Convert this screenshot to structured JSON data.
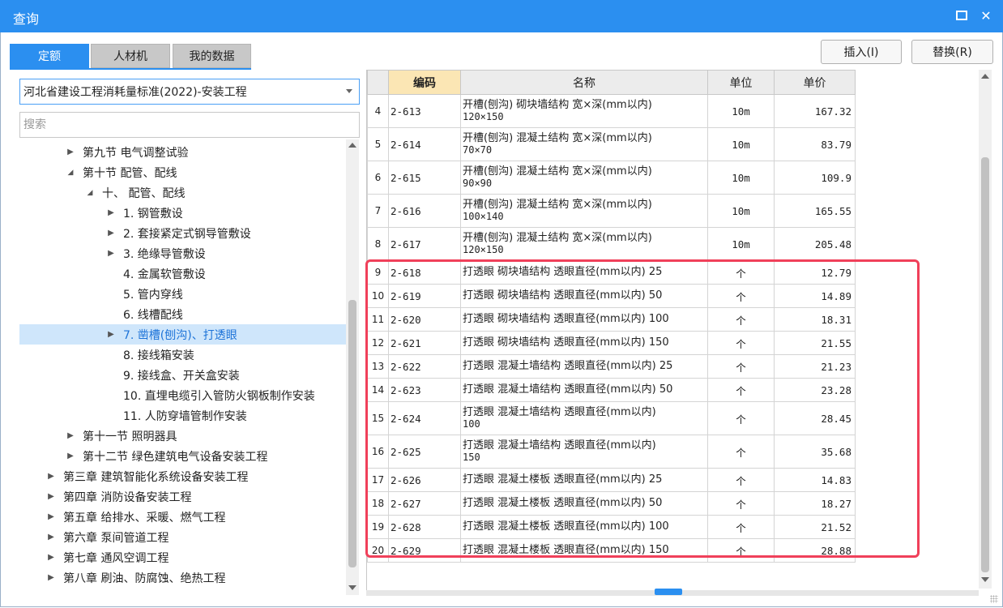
{
  "window": {
    "title": "查询"
  },
  "tabs": [
    {
      "label": "定额",
      "active": true
    },
    {
      "label": "人材机",
      "active": false
    },
    {
      "label": "我的数据",
      "active": false
    }
  ],
  "buttons": {
    "insert": "插入(I)",
    "replace": "替换(R)"
  },
  "library": {
    "selected": "河北省建设工程消耗量标准(2022)-安装工程"
  },
  "search": {
    "placeholder": "搜索",
    "value": ""
  },
  "tree": [
    {
      "label": "第九节 电气调整试验",
      "level": 2,
      "toggle": "collapsed"
    },
    {
      "label": "第十节 配管、配线",
      "level": 2,
      "toggle": "expanded"
    },
    {
      "label": "十、 配管、配线",
      "level": 3,
      "toggle": "expanded"
    },
    {
      "label": "1. 钢管敷设",
      "level": 4,
      "toggle": "collapsed"
    },
    {
      "label": "2. 套接紧定式钢导管敷设",
      "level": 4,
      "toggle": "collapsed"
    },
    {
      "label": "3. 绝缘导管敷设",
      "level": 4,
      "toggle": "collapsed"
    },
    {
      "label": "4. 金属软管敷设",
      "level": 4,
      "toggle": "none"
    },
    {
      "label": "5. 管内穿线",
      "level": 4,
      "toggle": "none"
    },
    {
      "label": "6. 线槽配线",
      "level": 4,
      "toggle": "none"
    },
    {
      "label": "7. 凿槽(刨沟)、打透眼",
      "level": 4,
      "toggle": "collapsed",
      "selected": true
    },
    {
      "label": "8. 接线箱安装",
      "level": 4,
      "toggle": "none"
    },
    {
      "label": "9. 接线盒、开关盒安装",
      "level": 4,
      "toggle": "none"
    },
    {
      "label": "10. 直埋电缆引入管防火钢板制作安装",
      "level": 4,
      "toggle": "none"
    },
    {
      "label": "11. 人防穿墙管制作安装",
      "level": 4,
      "toggle": "none"
    },
    {
      "label": "第十一节 照明器具",
      "level": 2,
      "toggle": "collapsed"
    },
    {
      "label": "第十二节 绿色建筑电气设备安装工程",
      "level": 2,
      "toggle": "collapsed"
    },
    {
      "label": "第三章 建筑智能化系统设备安装工程",
      "level": 1,
      "toggle": "collapsed"
    },
    {
      "label": "第四章 消防设备安装工程",
      "level": 1,
      "toggle": "collapsed"
    },
    {
      "label": "第五章 给排水、采暖、燃气工程",
      "level": 1,
      "toggle": "collapsed"
    },
    {
      "label": "第六章 泵间管道工程",
      "level": 1,
      "toggle": "collapsed"
    },
    {
      "label": "第七章 通风空调工程",
      "level": 1,
      "toggle": "collapsed"
    },
    {
      "label": "第八章 刷油、防腐蚀、绝热工程",
      "level": 1,
      "toggle": "collapsed"
    }
  ],
  "grid": {
    "columns": {
      "code": "编码",
      "name": "名称",
      "unit": "单位",
      "price": "单价"
    },
    "rows": [
      {
        "idx": "4",
        "code": "2-613",
        "name1": "开槽(刨沟) 砌块墙结构 宽×深(mm以内)",
        "name2": "120×150",
        "unit": "10m",
        "price": "167.32"
      },
      {
        "idx": "5",
        "code": "2-614",
        "name1": "开槽(刨沟) 混凝土结构 宽×深(mm以内)",
        "name2": "70×70",
        "unit": "10m",
        "price": "83.79"
      },
      {
        "idx": "6",
        "code": "2-615",
        "name1": "开槽(刨沟) 混凝土结构 宽×深(mm以内)",
        "name2": "90×90",
        "unit": "10m",
        "price": "109.9"
      },
      {
        "idx": "7",
        "code": "2-616",
        "name1": "开槽(刨沟) 混凝土结构 宽×深(mm以内)",
        "name2": "100×140",
        "unit": "10m",
        "price": "165.55"
      },
      {
        "idx": "8",
        "code": "2-617",
        "name1": "开槽(刨沟) 混凝土结构 宽×深(mm以内)",
        "name2": "120×150",
        "unit": "10m",
        "price": "205.48"
      },
      {
        "idx": "9",
        "code": "2-618",
        "name1": "打透眼 砌块墙结构 透眼直径(mm以内) 25",
        "unit": "个",
        "price": "12.79"
      },
      {
        "idx": "10",
        "code": "2-619",
        "name1": "打透眼 砌块墙结构 透眼直径(mm以内) 50",
        "unit": "个",
        "price": "14.89"
      },
      {
        "idx": "11",
        "code": "2-620",
        "name1": "打透眼 砌块墙结构 透眼直径(mm以内) 100",
        "unit": "个",
        "price": "18.31"
      },
      {
        "idx": "12",
        "code": "2-621",
        "name1": "打透眼 砌块墙结构 透眼直径(mm以内) 150",
        "unit": "个",
        "price": "21.55"
      },
      {
        "idx": "13",
        "code": "2-622",
        "name1": "打透眼 混凝土墙结构 透眼直径(mm以内) 25",
        "unit": "个",
        "price": "21.23"
      },
      {
        "idx": "14",
        "code": "2-623",
        "name1": "打透眼 混凝土墙结构 透眼直径(mm以内) 50",
        "unit": "个",
        "price": "23.28"
      },
      {
        "idx": "15",
        "code": "2-624",
        "name1": "打透眼 混凝土墙结构 透眼直径(mm以内)",
        "name2": "100",
        "unit": "个",
        "price": "28.45"
      },
      {
        "idx": "16",
        "code": "2-625",
        "name1": "打透眼 混凝土墙结构 透眼直径(mm以内)",
        "name2": "150",
        "unit": "个",
        "price": "35.68"
      },
      {
        "idx": "17",
        "code": "2-626",
        "name1": "打透眼 混凝土楼板 透眼直径(mm以内) 25",
        "unit": "个",
        "price": "14.83"
      },
      {
        "idx": "18",
        "code": "2-627",
        "name1": "打透眼 混凝土楼板 透眼直径(mm以内) 50",
        "unit": "个",
        "price": "18.27"
      },
      {
        "idx": "19",
        "code": "2-628",
        "name1": "打透眼 混凝土楼板 透眼直径(mm以内) 100",
        "unit": "个",
        "price": "21.52"
      },
      {
        "idx": "20",
        "code": "2-629",
        "name1": "打透眼 混凝土楼板 透眼直径(mm以内) 150",
        "unit": "个",
        "price": "28.88"
      }
    ]
  },
  "icons": {
    "restore": "restore-icon",
    "close": "close-icon",
    "dropdown": "chevron-down-icon"
  },
  "colors": {
    "accent": "#2b8ff0",
    "highlight": "#f0405a",
    "selected_bg": "#cfe6fb",
    "code_header": "#fbe6b4"
  }
}
